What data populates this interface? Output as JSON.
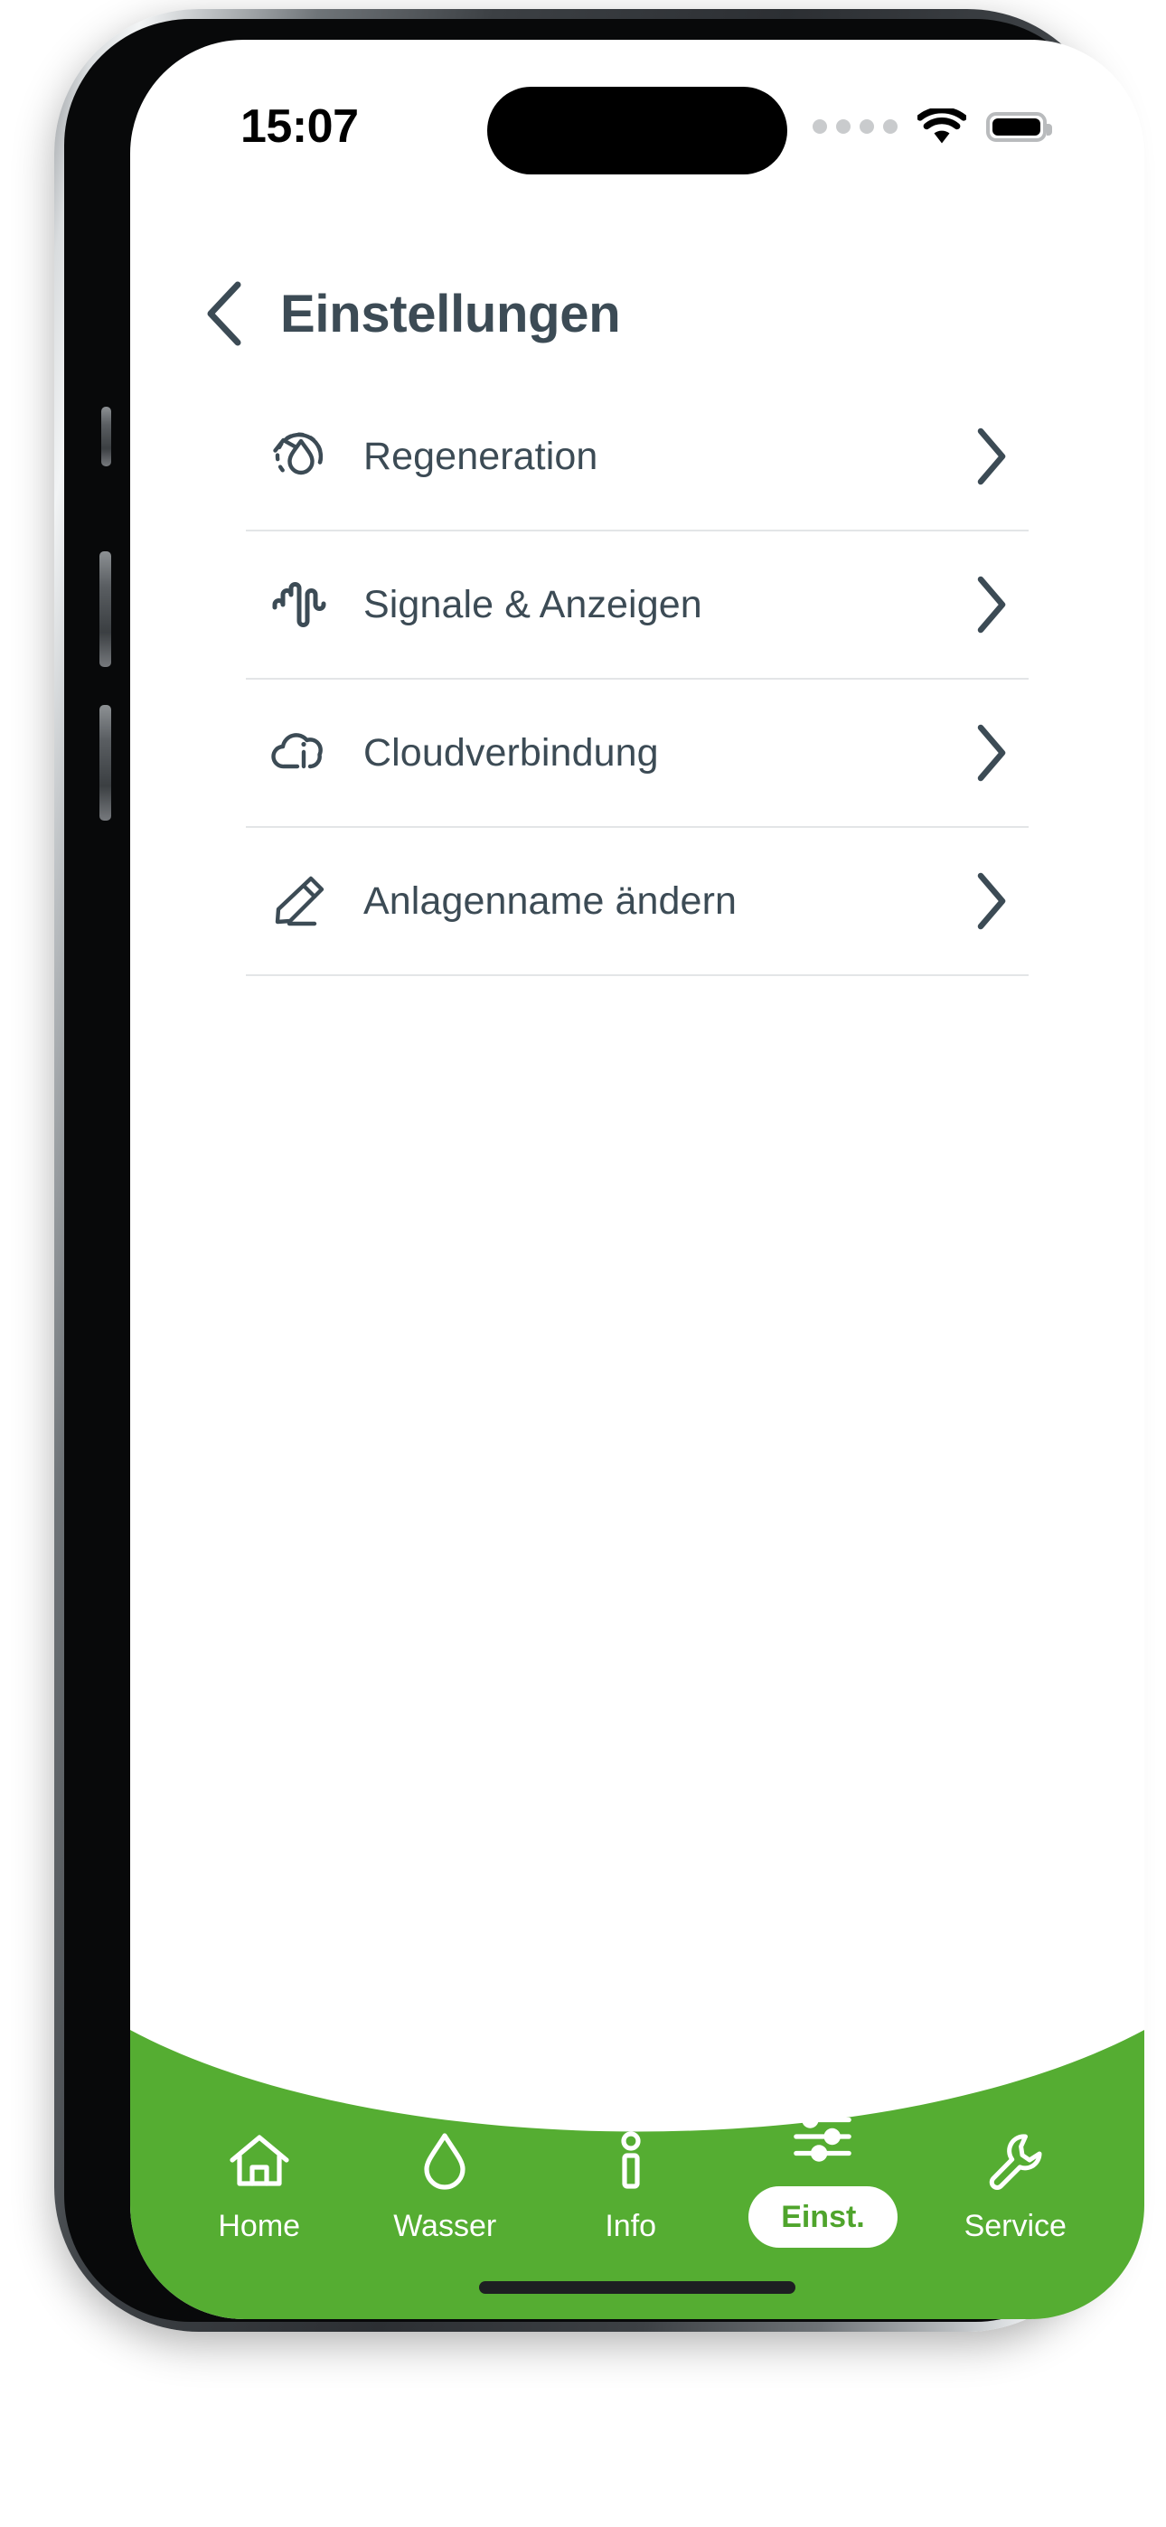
{
  "status_bar": {
    "time": "15:07",
    "cellular_icon": "cellular-dots-icon",
    "wifi_icon": "wifi-icon",
    "battery_icon": "battery-full-icon",
    "battery_level": "100"
  },
  "header": {
    "back_icon": "chevron-left-icon",
    "title": "Einstellungen"
  },
  "settings_list": [
    {
      "id": "regeneration",
      "label": "Regeneration",
      "icon": "regeneration-icon",
      "chevron": "chevron-right-icon"
    },
    {
      "id": "signale",
      "label": "Signale & Anzeigen",
      "icon": "waveform-icon",
      "chevron": "chevron-right-icon"
    },
    {
      "id": "cloud",
      "label": "Cloudverbindung",
      "icon": "cloud-info-icon",
      "chevron": "chevron-right-icon"
    },
    {
      "id": "anlagenname",
      "label": "Anlagenname ändern",
      "icon": "pencil-edit-icon",
      "chevron": "chevron-right-icon"
    }
  ],
  "bottom_nav": {
    "background_color": "#55ad32",
    "active_text_color": "#4fa42c",
    "items": [
      {
        "id": "home",
        "label": "Home",
        "icon": "house-icon",
        "active": false
      },
      {
        "id": "wasser",
        "label": "Wasser",
        "icon": "droplet-icon",
        "active": false
      },
      {
        "id": "info",
        "label": "Info",
        "icon": "info-icon",
        "active": false
      },
      {
        "id": "einst",
        "label": "Einst.",
        "icon": "sliders-icon",
        "active": true
      },
      {
        "id": "service",
        "label": "Service",
        "icon": "wrench-icon",
        "active": false
      }
    ]
  },
  "colors": {
    "brand_green": "#55ad32",
    "text_slate": "#3c4b55",
    "divider": "#e3e5e7",
    "screen_bg": "#ffffff"
  }
}
